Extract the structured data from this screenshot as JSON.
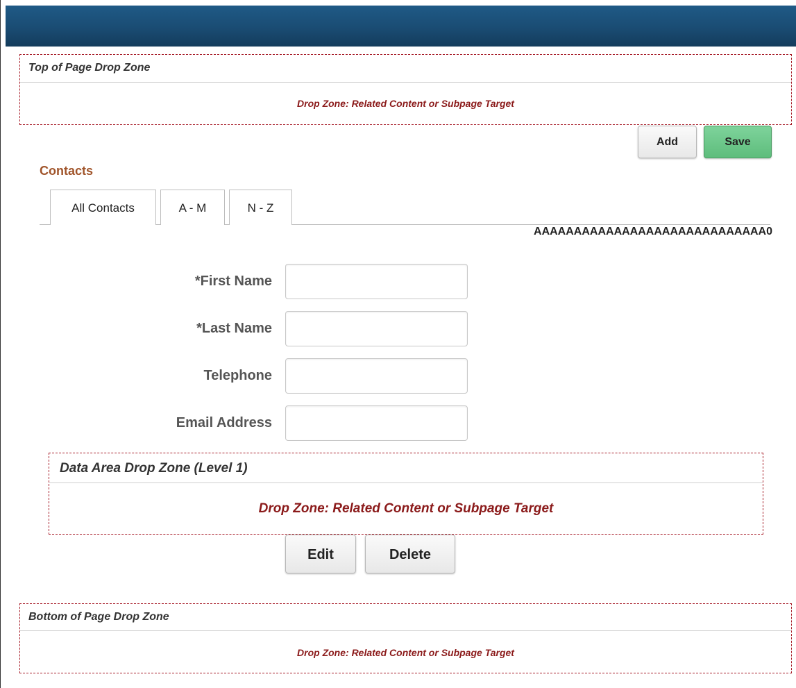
{
  "top_drop_zone": {
    "title": "Top of Page Drop Zone",
    "body": "Drop Zone: Related Content or Subpage Target"
  },
  "toolbar": {
    "add_label": "Add",
    "save_label": "Save"
  },
  "contacts": {
    "title": "Contacts",
    "tabs": [
      {
        "label": "All Contacts"
      },
      {
        "label": "A - M"
      },
      {
        "label": "N - Z"
      }
    ],
    "row_counter": "AAAAAAAAAAAAAAAAAAAAAAAAAAAAA0"
  },
  "form": {
    "first_name": {
      "label": "*First Name",
      "value": ""
    },
    "last_name": {
      "label": "*Last Name",
      "value": ""
    },
    "telephone": {
      "label": "Telephone",
      "value": ""
    },
    "email": {
      "label": "Email Address",
      "value": ""
    }
  },
  "data_drop_zone": {
    "title": "Data Area Drop Zone (Level 1)",
    "body": "Drop Zone: Related Content or Subpage Target"
  },
  "actions": {
    "edit_label": "Edit",
    "delete_label": "Delete"
  },
  "bottom_drop_zone": {
    "title": "Bottom of Page Drop Zone",
    "body": "Drop Zone: Related Content or Subpage Target"
  },
  "colors": {
    "header": "#1a4c73",
    "drop_zone_border": "#a81e2a",
    "drop_zone_text": "#8b1a1a",
    "section_title": "#a0542a",
    "save_button": "#6cc98a"
  }
}
